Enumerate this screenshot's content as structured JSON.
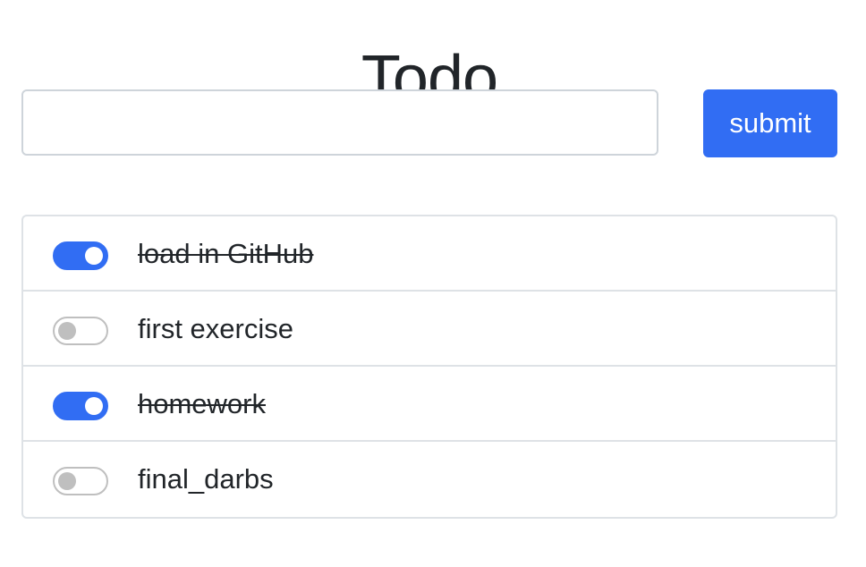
{
  "app": {
    "title": "Todo"
  },
  "form": {
    "input_value": "",
    "input_placeholder": "",
    "submit_label": "submit"
  },
  "colors": {
    "accent": "#316df3",
    "toggle_off": "#bfbfbf",
    "border": "#dee2e6",
    "text": "#212529"
  },
  "todos": [
    {
      "text": "load in GitHub",
      "done": true
    },
    {
      "text": "first exercise",
      "done": false
    },
    {
      "text": "homework",
      "done": true
    },
    {
      "text": "final_darbs",
      "done": false
    }
  ]
}
